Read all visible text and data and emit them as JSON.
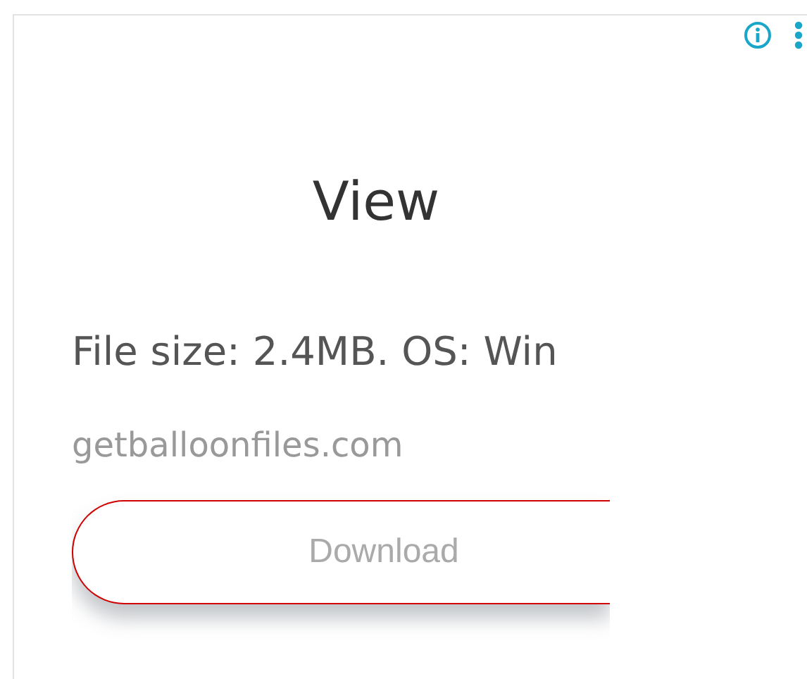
{
  "title": "View",
  "details": "File size: 2.4MB. OS: Win",
  "domain": "getballoonfiles.com",
  "button": {
    "label": "Download"
  }
}
